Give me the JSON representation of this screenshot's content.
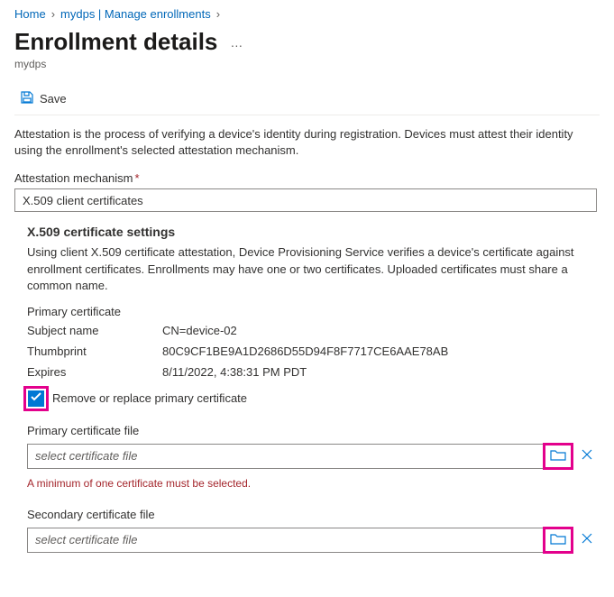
{
  "breadcrumb": {
    "home": "Home",
    "mid": "mydps | Manage enrollments"
  },
  "page": {
    "title": "Enrollment details",
    "subtitle": "mydps"
  },
  "commands": {
    "save": "Save"
  },
  "attestation": {
    "description": "Attestation is the process of verifying a device's identity during registration. Devices must attest their identity using the enrollment's selected attestation mechanism.",
    "label": "Attestation mechanism",
    "value": "X.509 client certificates"
  },
  "x509": {
    "heading": "X.509 certificate settings",
    "description": "Using client X.509 certificate attestation, Device Provisioning Service verifies a device's certificate against enrollment certificates. Enrollments may have one or two certificates. Uploaded certificates must share a common name.",
    "primary_label": "Primary certificate",
    "subject_label": "Subject name",
    "subject_value": "CN=device-02",
    "thumbprint_label": "Thumbprint",
    "thumbprint_value": "80C9CF1BE9A1D2686D55D94F8F7717CE6AAE78AB",
    "expires_label": "Expires",
    "expires_value": "8/11/2022, 4:38:31 PM PDT",
    "remove_replace_label": "Remove or replace primary certificate",
    "primary_file_label": "Primary certificate file",
    "file_placeholder": "select certificate file",
    "error": "A minimum of one certificate must be selected.",
    "secondary_file_label": "Secondary certificate file"
  }
}
